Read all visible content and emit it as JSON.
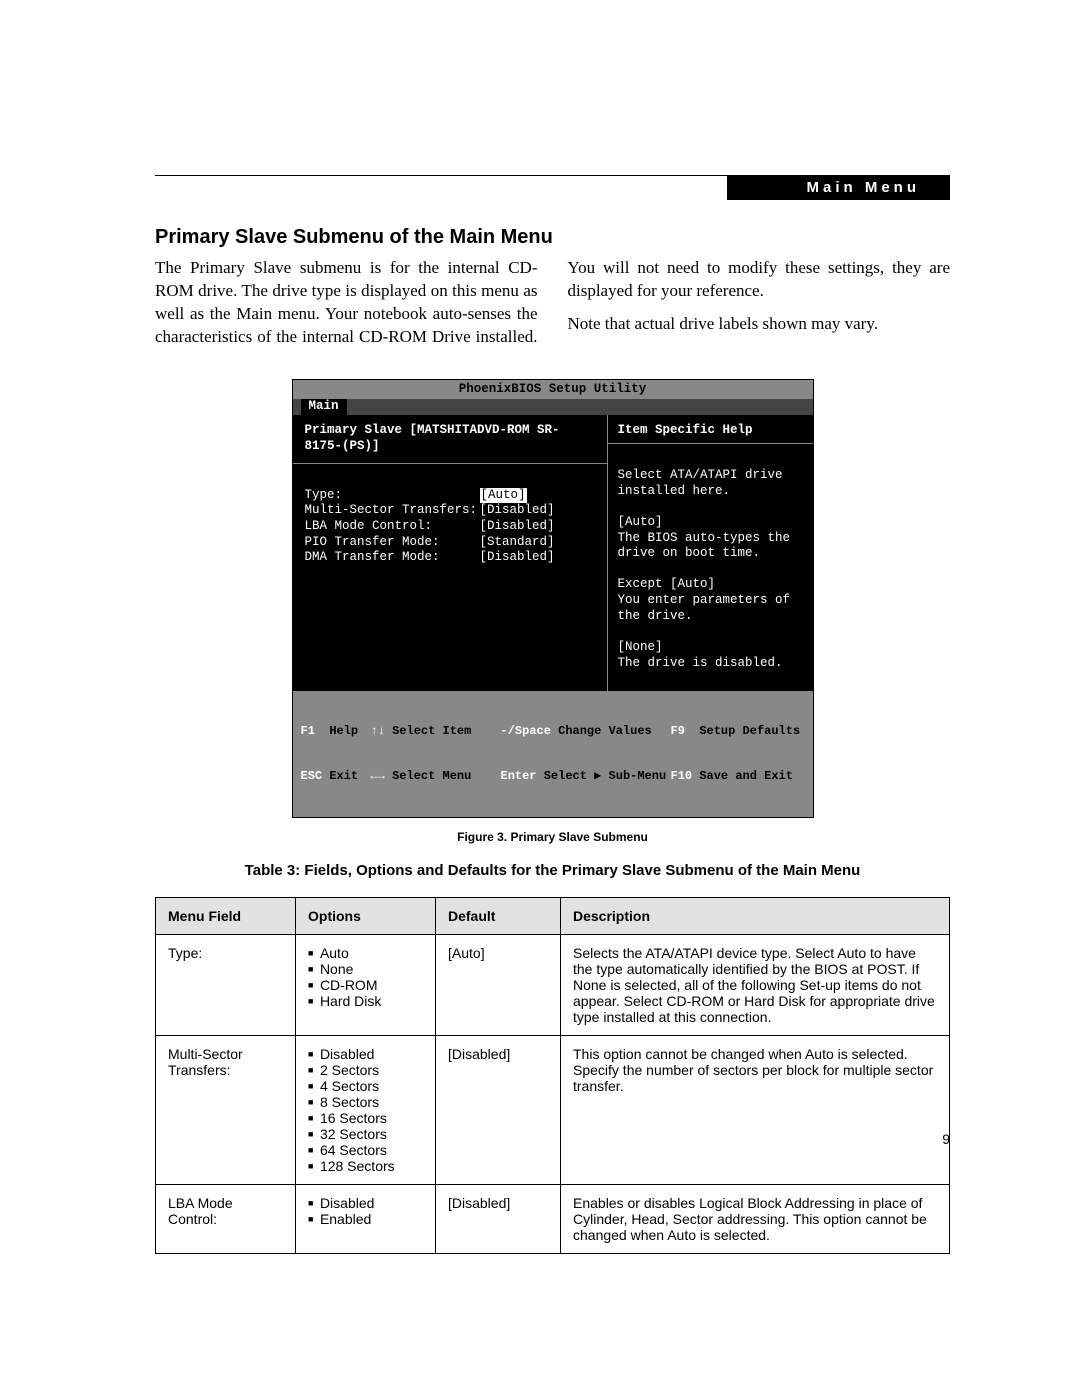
{
  "header": {
    "label": "Main Menu"
  },
  "section_title": "Primary Slave Submenu of the Main Menu",
  "body_text": "The Primary Slave submenu is for the internal CD-ROM drive. The drive type is displayed on this menu as well as the Main menu. Your notebook auto-senses the characteristics of the internal CD-ROM Drive installed. You will not need to modify these settings, they are displayed for your reference.",
  "body_note": "Note that actual drive labels shown may vary.",
  "bios": {
    "title": "PhoenixBIOS Setup Utility",
    "tab": "Main",
    "left_header": "Primary Slave [MATSHITADVD-ROM SR-8175-(PS)]",
    "right_header": "Item Specific Help",
    "fields": [
      {
        "k": "Type:",
        "v": "[Auto]",
        "highlight": true
      },
      {
        "k": "",
        "v": ""
      },
      {
        "k": "Multi-Sector Transfers:",
        "v": "[Disabled]"
      },
      {
        "k": "LBA Mode Control:",
        "v": "[Disabled]"
      },
      {
        "k": "PIO Transfer Mode:",
        "v": "[Standard]"
      },
      {
        "k": "DMA Transfer Mode:",
        "v": "[Disabled]"
      }
    ],
    "help_lines": [
      "Select ATA/ATAPI drive",
      "installed here.",
      "",
      "[Auto]",
      "The BIOS auto-types the",
      "drive on boot time.",
      "",
      "Except [Auto]",
      "You enter parameters of",
      "the drive.",
      "",
      "[None]",
      "The drive is disabled."
    ],
    "footer": {
      "r1c1k": "F1",
      "r1c1l": "Help",
      "r1c2k": "↑↓",
      "r1c2l": "Select Item",
      "r1c3k": "-/Space",
      "r1c3l": "Change Values",
      "r1c4k": "F9",
      "r1c4l": "Setup Defaults",
      "r2c1k": "ESC",
      "r2c1l": "Exit",
      "r2c2k": "←→",
      "r2c2l": "Select Menu",
      "r2c3k": "Enter",
      "r2c3l": "Select ▶ Sub-Menu",
      "r2c4k": "F10",
      "r2c4l": "Save and Exit"
    }
  },
  "figure_caption": "Figure 3.  Primary Slave Submenu",
  "table_caption": "Table 3: Fields, Options and Defaults for the Primary Slave Submenu of the Main Menu",
  "table": {
    "headers": [
      "Menu Field",
      "Options",
      "Default",
      "Description"
    ],
    "rows": [
      {
        "field": "Type:",
        "options": [
          "Auto",
          "None",
          "CD-ROM",
          "Hard Disk"
        ],
        "def": "[Auto]",
        "desc": "Selects the ATA/ATAPI device type. Select Auto to have the type automatically identified by the BIOS at POST. If None is selected, all of the following Set-up items do not appear. Select CD-ROM or Hard Disk for appropriate drive type installed at this connection."
      },
      {
        "field": "Multi-Sector Transfers:",
        "options": [
          "Disabled",
          "2 Sectors",
          "4 Sectors",
          "8 Sectors",
          "16 Sectors",
          "32 Sectors",
          "64 Sectors",
          "128 Sectors"
        ],
        "def": "[Disabled]",
        "desc": "This option cannot be changed when Auto is selected. Specify the number of sectors per block for multiple sector transfer."
      },
      {
        "field": "LBA Mode Control:",
        "options": [
          "Disabled",
          "Enabled"
        ],
        "def": "[Disabled]",
        "desc": "Enables or disables Logical Block Addressing in place of Cylinder, Head, Sector addressing. This option cannot be changed when Auto is selected."
      }
    ]
  },
  "page_number": "9"
}
